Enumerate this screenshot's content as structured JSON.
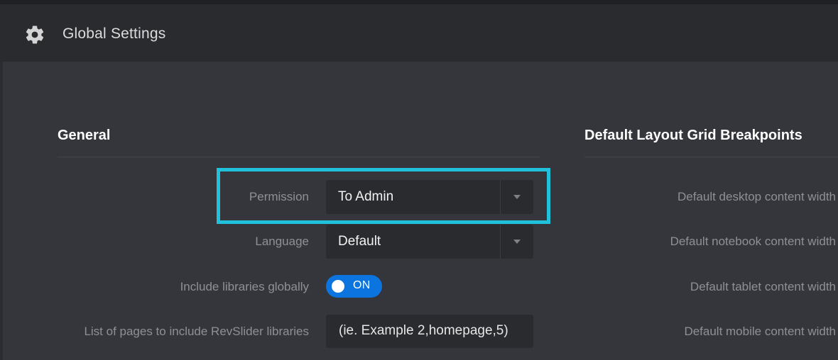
{
  "header": {
    "title": "Global Settings",
    "icon": "gear-icon"
  },
  "general": {
    "section_title": "General",
    "permission": {
      "label": "Permission",
      "value": "To Admin"
    },
    "language": {
      "label": "Language",
      "value": "Default"
    },
    "include_libraries": {
      "label": "Include libraries globally",
      "state": "ON"
    },
    "include_pages": {
      "label": "List of pages to include RevSlider libraries",
      "value": "(ie. Example 2,homepage,5)"
    }
  },
  "breakpoints": {
    "section_title": "Default Layout Grid Breakpoints",
    "items": [
      {
        "label": "Default desktop content width"
      },
      {
        "label": "Default notebook content width"
      },
      {
        "label": "Default tablet content width"
      },
      {
        "label": "Default mobile content width"
      }
    ]
  },
  "colors": {
    "background": "#35363b",
    "titlebar": "#2a2b2f",
    "highlight": "#21c0db",
    "toggle_on": "#0c74df",
    "label": "#8f9096"
  }
}
